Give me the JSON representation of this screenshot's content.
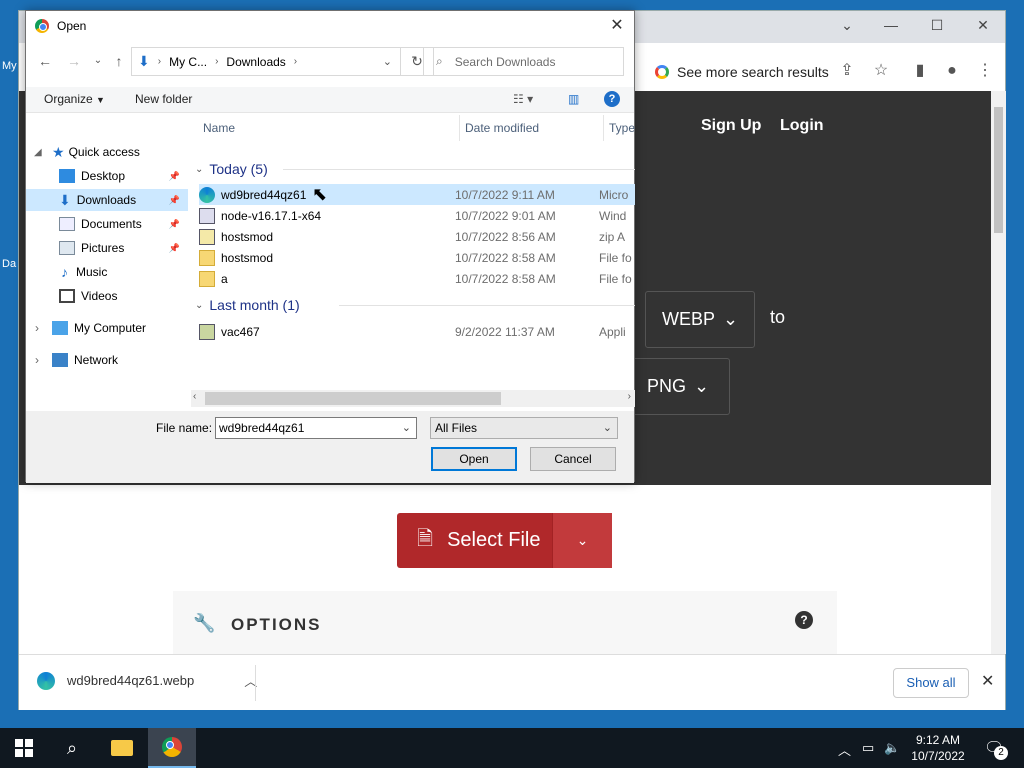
{
  "desktop": {
    "label1": "My",
    "label2": "Da"
  },
  "dialog": {
    "title": "Open",
    "close": "✕",
    "breadcrumb": [
      "My C...",
      "Downloads"
    ],
    "search_placeholder": "Search Downloads",
    "organize": "Organize",
    "new_folder": "New folder",
    "nav": [
      {
        "label": "Quick access",
        "pinned": false
      },
      {
        "label": "Desktop",
        "pinned": true
      },
      {
        "label": "Downloads",
        "pinned": true
      },
      {
        "label": "Documents",
        "pinned": true
      },
      {
        "label": "Pictures",
        "pinned": true
      },
      {
        "label": "Music",
        "pinned": false
      },
      {
        "label": "Videos",
        "pinned": false
      },
      {
        "label": "My Computer",
        "pinned": false
      },
      {
        "label": "Network",
        "pinned": false
      }
    ],
    "columns": {
      "name": "Name",
      "date": "Date modified",
      "type": "Type"
    },
    "groups": [
      {
        "label": "Today (5)",
        "files": [
          {
            "name": "wd9bred44qz61",
            "date": "10/7/2022 9:11 AM",
            "type": "Micro"
          },
          {
            "name": "node-v16.17.1-x64",
            "date": "10/7/2022 9:01 AM",
            "type": "Wind"
          },
          {
            "name": "hostsmod",
            "date": "10/7/2022 8:56 AM",
            "type": "zip A"
          },
          {
            "name": "hostsmod",
            "date": "10/7/2022 8:58 AM",
            "type": "File fo"
          },
          {
            "name": "a",
            "date": "10/7/2022 8:58 AM",
            "type": "File fo"
          }
        ]
      },
      {
        "label": "Last month (1)",
        "files": [
          {
            "name": "vac467",
            "date": "9/2/2022 11:37 AM",
            "type": "Appli"
          }
        ]
      }
    ],
    "file_name_label": "File name:",
    "file_name_value": "wd9bred44qz61",
    "file_type": "All Files",
    "open_btn": "Open",
    "cancel_btn": "Cancel"
  },
  "chrome": {
    "omnibox_hint": "See more search results",
    "nav_signup": "Sign Up",
    "nav_login": "Login",
    "from_format": "WEBP",
    "to_text": "to",
    "to_format": "PNG",
    "select_file": "Select File",
    "options_title": "OPTIONS",
    "download_file": "wd9bred44qz61.webp",
    "show_all": "Show all"
  },
  "taskbar": {
    "time": "9:12 AM",
    "date": "10/7/2022",
    "notifications": "2"
  }
}
